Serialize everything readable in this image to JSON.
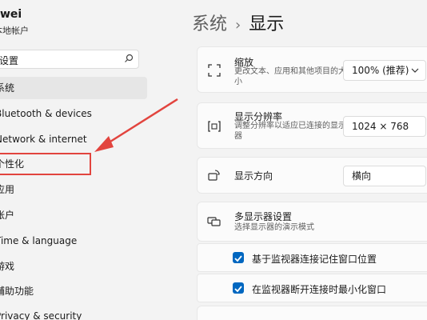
{
  "user": {
    "name": "wei",
    "account_type": "本地帐户"
  },
  "search": {
    "value": "设置"
  },
  "sidebar": {
    "items": [
      {
        "label": "系统"
      },
      {
        "label": "Bluetooth & devices"
      },
      {
        "label": "Network & internet"
      },
      {
        "label": "个性化"
      },
      {
        "label": "应用"
      },
      {
        "label": "帐户"
      },
      {
        "label": "Time & language"
      },
      {
        "label": "游戏"
      },
      {
        "label": "辅助功能"
      },
      {
        "label": "Privacy & security"
      }
    ]
  },
  "breadcrumb": {
    "parent": "系统",
    "separator": "›",
    "current": "显示"
  },
  "settings": {
    "scale": {
      "title": "缩放",
      "desc": "更改文本、应用和其他项目的大小",
      "value": "100% (推荐)"
    },
    "resolution": {
      "title": "显示分辨率",
      "desc": "调整分辨率以适应已连接的显示器",
      "value": "1024 × 768"
    },
    "orientation": {
      "title": "显示方向",
      "value": "横向"
    },
    "multi_display": {
      "title": "多显示器设置",
      "desc": "选择显示器的演示模式"
    },
    "remember_windows": {
      "label": "基于监视器连接记住窗口位置"
    },
    "minimize_windows": {
      "label": "在监视器断开连接时最小化窗口"
    }
  },
  "colors": {
    "accent": "#0067c0",
    "annotation": "#e2443e"
  }
}
